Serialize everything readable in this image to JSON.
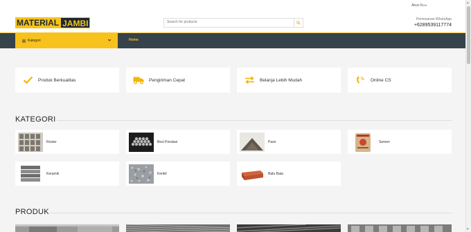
{
  "topbar": {
    "account_label": "Akun Ku",
    "caret": "▾"
  },
  "header": {
    "logo_part1": "MATERIAL",
    "logo_part2": "JAMBI",
    "search_placeholder": "Search for products",
    "whatsapp_label": "Pemesanan WhatsApp",
    "whatsapp_number": "+6289539117774"
  },
  "nav": {
    "category_label": "Kategori",
    "home_label": "Home"
  },
  "features": [
    {
      "label": "Produk Berkualitas",
      "icon": "check-icon"
    },
    {
      "label": "Pengiriman Cepat",
      "icon": "truck-icon"
    },
    {
      "label": "Belanja Lebih Mudah",
      "icon": "exchange-icon"
    },
    {
      "label": "Online CS",
      "icon": "phone-icon"
    }
  ],
  "sections": {
    "kategori": "KATEGORI",
    "produk": "PRODUK"
  },
  "categories": [
    {
      "name": "Roster"
    },
    {
      "name": "Besi Pondasi"
    },
    {
      "name": "Pasir"
    },
    {
      "name": "Semen"
    },
    {
      "name": "Keramik"
    },
    {
      "name": "Kerikil"
    },
    {
      "name": "Batu Bata"
    }
  ],
  "colors": {
    "accent": "#f7c21c",
    "nav_bg": "#37434b",
    "dark": "#1d2930"
  }
}
